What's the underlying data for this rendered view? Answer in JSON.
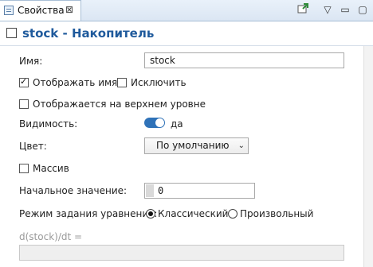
{
  "tab": {
    "label": "Свойства",
    "close": "⊠"
  },
  "toolbar": {
    "pin_icon": "pin-icon",
    "menu": "▽",
    "minimize": "▭",
    "maximize": "▢"
  },
  "title": "stock - Накопитель",
  "name": {
    "label": "Имя:",
    "value": "stock"
  },
  "show_name": {
    "label": "Отображать имя",
    "checked": true
  },
  "exclude": {
    "label": "Исключить",
    "checked": false
  },
  "top_level": {
    "label": "Отображается на верхнем уровне",
    "checked": false
  },
  "visibility": {
    "label": "Видимость:",
    "value": "да"
  },
  "color": {
    "label": "Цвет:",
    "value": "По умолчанию"
  },
  "array": {
    "label": "Массив",
    "checked": false
  },
  "initial": {
    "label": "Начальное значение:",
    "value": "0"
  },
  "mode": {
    "label": "Режим задания уравнения:",
    "options": [
      "Классический",
      "Произвольный"
    ],
    "selected": "Классический"
  },
  "equation": {
    "label": "d(stock)/dt ="
  }
}
